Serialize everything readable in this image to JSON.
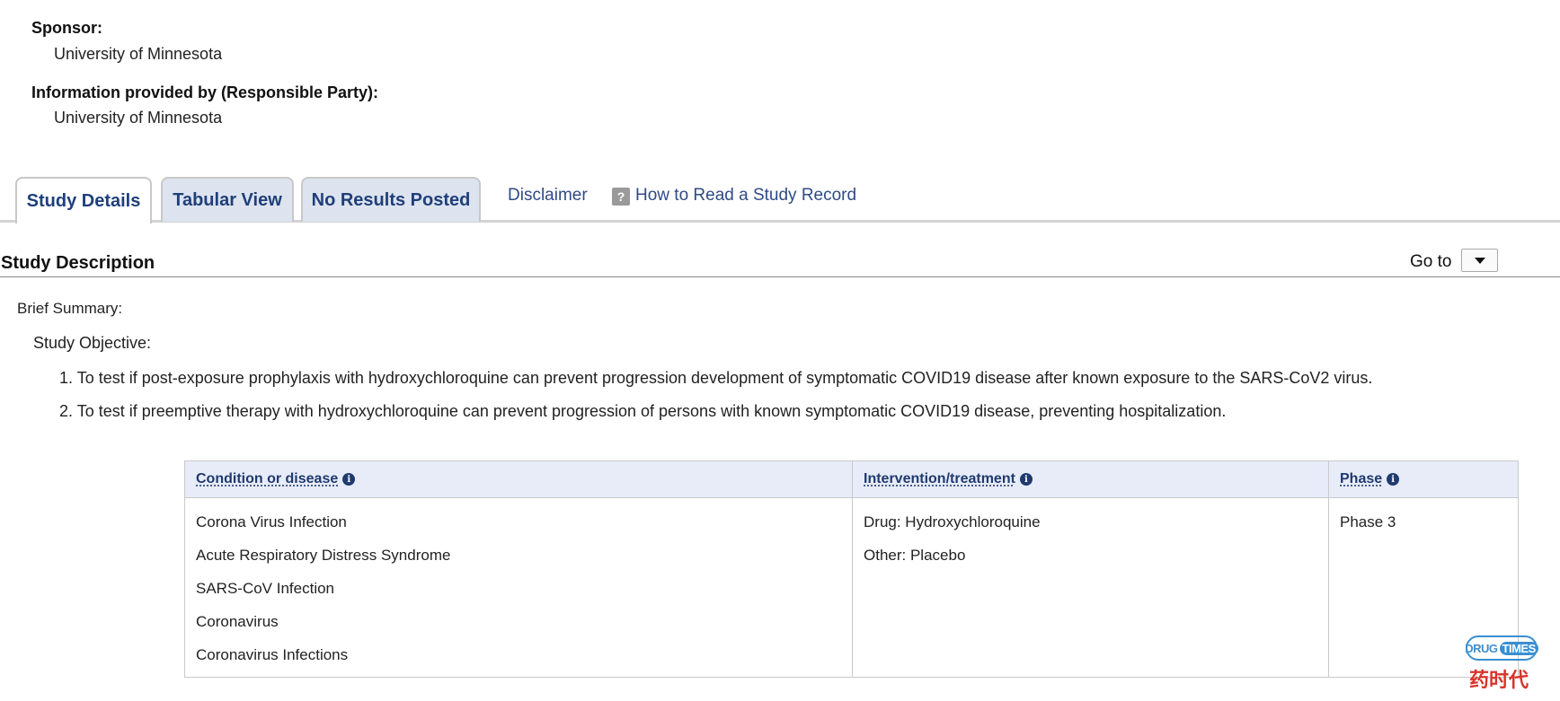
{
  "sponsor": {
    "label": "Sponsor:",
    "value": "University of Minnesota"
  },
  "responsible_party": {
    "label": "Information provided by (Responsible Party):",
    "value": "University of Minnesota"
  },
  "tabs": [
    {
      "label": "Study Details",
      "active": true
    },
    {
      "label": "Tabular View",
      "active": false
    },
    {
      "label": "No Results Posted",
      "active": false
    }
  ],
  "links": {
    "disclaimer": "Disclaimer",
    "how_to_read": "How to Read a Study Record",
    "help_icon_glyph": "?"
  },
  "section": {
    "title": "Study Description",
    "goto_label": "Go to"
  },
  "summary": {
    "label": "Brief Summary:",
    "objective_label": "Study Objective:",
    "objectives": [
      "1. To test if post-exposure prophylaxis with hydroxychloroquine can prevent progression development of symptomatic COVID19 disease after known exposure to the SARS-CoV2 virus.",
      "2. To test if preemptive therapy with hydroxychloroquine can prevent progression of persons with known symptomatic COVID19 disease, preventing hospitalization."
    ]
  },
  "table": {
    "headers": {
      "condition": "Condition or disease",
      "intervention": "Intervention/treatment",
      "phase": "Phase"
    },
    "conditions": [
      "Corona Virus Infection",
      "Acute Respiratory Distress Syndrome",
      "SARS-CoV Infection",
      "Coronavirus",
      "Coronavirus Infections"
    ],
    "interventions": [
      "Drug: Hydroxychloroquine",
      "Other: Placebo"
    ],
    "phases": [
      "Phase 3"
    ]
  },
  "watermark": {
    "brand_left": "DRUG",
    "brand_right": "TIMES",
    "brand_cn": "药时代"
  },
  "colors": {
    "tab_text": "#1f3f7a",
    "tab_bg": "#dde3ef",
    "table_header_bg": "#e8ecf9",
    "link": "#2f4a86",
    "watermark_blue": "#3a8fd0",
    "watermark_red": "#d9332b"
  }
}
